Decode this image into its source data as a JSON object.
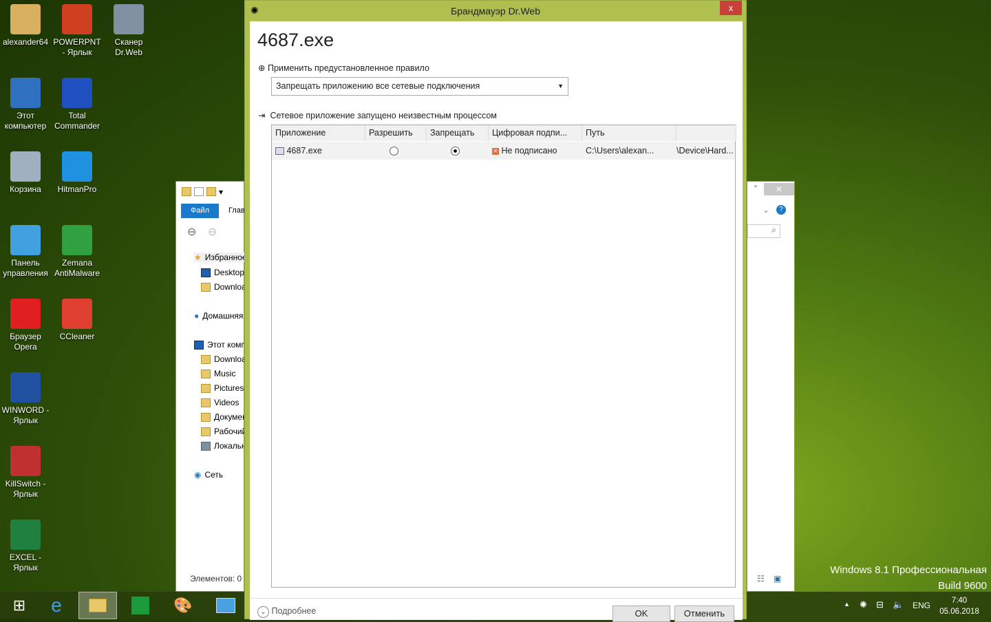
{
  "desktop": {
    "icons": [
      {
        "label": "alexander64",
        "color": "#d8b060"
      },
      {
        "label": "POWERPNT - Ярлык",
        "color": "#d04020"
      },
      {
        "label": "Сканер Dr.Web",
        "color": "#8090a0"
      },
      {
        "label": "Этот компьютер",
        "color": "#3070c0"
      },
      {
        "label": "Total Commander",
        "color": "#2050c0"
      },
      {
        "label": "Корзина",
        "color": "#a0b0c0"
      },
      {
        "label": "HitmanPro",
        "color": "#2090e0"
      },
      {
        "label": "Панель управления",
        "color": "#40a0e0"
      },
      {
        "label": "Zemana AntiMalware",
        "color": "#30a040"
      },
      {
        "label": "Браузер Opera",
        "color": "#e02020"
      },
      {
        "label": "CCleaner",
        "color": "#e04030"
      },
      {
        "label": "WINWORD - Ярлык",
        "color": "#2050a0"
      },
      {
        "label": "KillSwitch - Ярлык",
        "color": "#c03030"
      },
      {
        "label": "EXCEL - Ярлык",
        "color": "#208040"
      }
    ]
  },
  "explorer": {
    "tab_file": "Файл",
    "tab_home": "Глав",
    "favorites": "Избранное",
    "desktop": "Desktop",
    "downloads": "Downloads",
    "homegroup": "Домашняя",
    "this_pc": "Этот компьютер",
    "pc_items": [
      "Downloads",
      "Music",
      "Pictures",
      "Videos",
      "Документы",
      "Рабочий",
      "Локальный"
    ],
    "network": "Сеть",
    "status": "Элементов: 0"
  },
  "dialog": {
    "title": "Брандмауэр Dr.Web",
    "close": "x",
    "app_name": "4687.exe",
    "rule_label": "Применить предустановленное правило",
    "rule_value": "Запрещать приложению все сетевые подключения",
    "info": "Сетевое приложение запущено неизвестным процессом",
    "columns": [
      "Приложение",
      "Разрешить",
      "Запрещать",
      "Цифровая подпи...",
      "Путь",
      ""
    ],
    "row": {
      "app": "4687.exe",
      "allow": false,
      "deny": true,
      "signature": "Не подписано",
      "path": "C:\\Users\\alexan...",
      "device": "\\Device\\Hard..."
    },
    "details": "Подробнее",
    "ok": "OK",
    "cancel": "Отменить"
  },
  "watermark": {
    "line1": "Windows 8.1 Профессиональная",
    "line2": "Build 9600"
  },
  "tray": {
    "lang": "ENG",
    "time": "7:40",
    "date": "05.06.2018"
  }
}
